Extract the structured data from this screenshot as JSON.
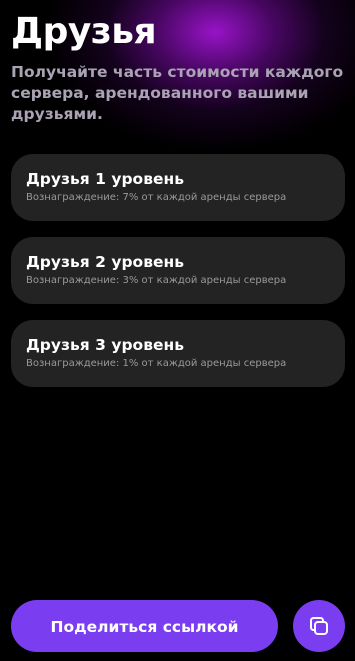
{
  "header": {
    "title": "Друзья",
    "subtitle": "Получайте часть стоимости каждого сервера, арендованного вашими друзьями."
  },
  "levels": [
    {
      "title": "Друзья 1 уровень",
      "description": "Вознаграждение: 7% от каждой аренды сервера"
    },
    {
      "title": "Друзья 2 уровень",
      "description": "Вознаграждение: 3% от каждой аренды сервера"
    },
    {
      "title": "Друзья 3 уровень",
      "description": "Вознаграждение: 1% от каждой аренды сервера"
    }
  ],
  "actions": {
    "share_label": "Поделиться ссылкой",
    "copy_icon": "copy-icon"
  },
  "colors": {
    "background": "#000000",
    "card": "#232323",
    "accent": "#7a3df0",
    "glow": "#a014d2",
    "subtitle": "#aaa3b3",
    "muted_text": "#9a9a9a"
  }
}
